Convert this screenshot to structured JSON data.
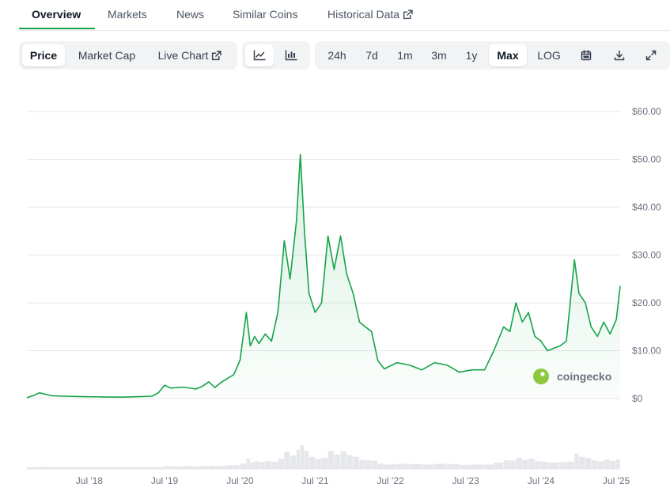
{
  "tabs": {
    "overview": "Overview",
    "markets": "Markets",
    "news": "News",
    "similar": "Similar Coins",
    "historical": "Historical Data"
  },
  "toolbar": {
    "price": "Price",
    "market_cap": "Market Cap",
    "live_chart": "Live Chart",
    "ranges": [
      "24h",
      "7d",
      "1m",
      "3m",
      "1y",
      "Max"
    ],
    "selected_range": "Max",
    "log": "LOG"
  },
  "watermark": "coingecko",
  "colors": {
    "line": "#16a34a",
    "accent": "#16a34a",
    "grid": "#e5e7eb"
  },
  "chart_data": {
    "type": "area",
    "ylim": [
      0,
      60
    ],
    "yticks": [
      0,
      10,
      20,
      30,
      40,
      50,
      60
    ],
    "ytick_labels": [
      "$0",
      "$10.00",
      "$20.00",
      "$30.00",
      "$40.00",
      "$50.00",
      "$60.00"
    ],
    "xticks": [
      "2018-07-01",
      "2019-07-01",
      "2020-07-01",
      "2021-07-01",
      "2022-07-01",
      "2023-07-01",
      "2024-07-01",
      "2025-07-01"
    ],
    "xtick_labels": [
      "Jul '18",
      "Jul '19",
      "Jul '20",
      "Jul '21",
      "Jul '22",
      "Jul '23",
      "Jul '24",
      "Jul '25"
    ],
    "grid": true,
    "series": [
      {
        "points": [
          [
            "2017-09-01",
            0.2
          ],
          [
            "2017-10-01",
            0.6
          ],
          [
            "2017-11-01",
            1.2
          ],
          [
            "2017-12-01",
            0.9
          ],
          [
            "2018-01-01",
            0.6
          ],
          [
            "2018-03-01",
            0.5
          ],
          [
            "2018-06-01",
            0.4
          ],
          [
            "2018-09-01",
            0.35
          ],
          [
            "2018-12-01",
            0.3
          ],
          [
            "2019-03-01",
            0.4
          ],
          [
            "2019-05-01",
            0.5
          ],
          [
            "2019-06-01",
            1.2
          ],
          [
            "2019-07-01",
            2.8
          ],
          [
            "2019-08-01",
            2.2
          ],
          [
            "2019-10-01",
            2.4
          ],
          [
            "2019-12-01",
            2.0
          ],
          [
            "2020-01-01",
            2.6
          ],
          [
            "2020-02-01",
            3.5
          ],
          [
            "2020-03-01",
            2.3
          ],
          [
            "2020-04-01",
            3.4
          ],
          [
            "2020-05-01",
            4.2
          ],
          [
            "2020-06-01",
            5.0
          ],
          [
            "2020-07-01",
            8.0
          ],
          [
            "2020-08-01",
            18.0
          ],
          [
            "2020-08-20",
            11.0
          ],
          [
            "2020-09-10",
            13.0
          ],
          [
            "2020-10-01",
            11.5
          ],
          [
            "2020-11-01",
            13.5
          ],
          [
            "2020-12-01",
            12.0
          ],
          [
            "2021-01-01",
            18.0
          ],
          [
            "2021-02-01",
            33.0
          ],
          [
            "2021-03-01",
            25.0
          ],
          [
            "2021-04-01",
            37.0
          ],
          [
            "2021-04-20",
            51.0
          ],
          [
            "2021-05-10",
            35.0
          ],
          [
            "2021-06-01",
            22.0
          ],
          [
            "2021-07-01",
            18.0
          ],
          [
            "2021-08-01",
            20.0
          ],
          [
            "2021-09-01",
            34.0
          ],
          [
            "2021-10-01",
            27.0
          ],
          [
            "2021-11-01",
            34.0
          ],
          [
            "2021-12-01",
            26.0
          ],
          [
            "2022-01-01",
            22.0
          ],
          [
            "2022-02-01",
            16.0
          ],
          [
            "2022-03-01",
            15.0
          ],
          [
            "2022-04-01",
            14.0
          ],
          [
            "2022-05-01",
            8.0
          ],
          [
            "2022-06-01",
            6.2
          ],
          [
            "2022-08-01",
            7.5
          ],
          [
            "2022-10-01",
            7.0
          ],
          [
            "2022-12-01",
            6.0
          ],
          [
            "2023-02-01",
            7.5
          ],
          [
            "2023-04-01",
            7.0
          ],
          [
            "2023-06-01",
            5.5
          ],
          [
            "2023-08-01",
            6.0
          ],
          [
            "2023-10-01",
            6.0
          ],
          [
            "2023-11-15",
            10.0
          ],
          [
            "2024-01-01",
            15.0
          ],
          [
            "2024-02-01",
            14.0
          ],
          [
            "2024-03-01",
            20.0
          ],
          [
            "2024-04-01",
            16.0
          ],
          [
            "2024-05-01",
            18.0
          ],
          [
            "2024-06-01",
            13.0
          ],
          [
            "2024-07-01",
            12.0
          ],
          [
            "2024-08-01",
            10.0
          ],
          [
            "2024-10-01",
            11.0
          ],
          [
            "2024-11-01",
            12.0
          ],
          [
            "2024-12-10",
            29.0
          ],
          [
            "2025-01-01",
            22.0
          ],
          [
            "2025-02-01",
            20.0
          ],
          [
            "2025-03-01",
            15.0
          ],
          [
            "2025-04-01",
            13.0
          ],
          [
            "2025-05-01",
            16.0
          ],
          [
            "2025-06-01",
            13.5
          ],
          [
            "2025-07-01",
            16.5
          ],
          [
            "2025-07-20",
            23.5
          ]
        ]
      }
    ]
  }
}
